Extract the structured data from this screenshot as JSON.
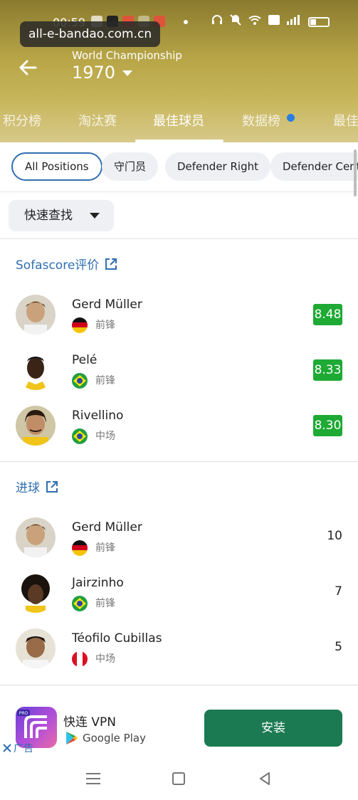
{
  "status_bar": {
    "time": "00:59"
  },
  "url_badge": "all-e-bandao.com.cn",
  "header": {
    "subtitle": "World Championship",
    "season": "1970"
  },
  "tabs": [
    {
      "label": "积分榜"
    },
    {
      "label": "淘汰赛"
    },
    {
      "label": "最佳球员"
    },
    {
      "label": "数据榜"
    },
    {
      "label": "最佳"
    }
  ],
  "chips": [
    "All Positions",
    "守门员",
    "Defender Right",
    "Defender Center"
  ],
  "quick_find": "快速查找",
  "sections": [
    {
      "title": "Sofascore评价",
      "players": [
        {
          "name": "Gerd Müller",
          "position": "前锋",
          "country": "germany",
          "value": "8.48"
        },
        {
          "name": "Pelé",
          "position": "前锋",
          "country": "brazil",
          "value": "8.33"
        },
        {
          "name": "Rivellino",
          "position": "中场",
          "country": "brazil",
          "value": "8.30"
        }
      ]
    },
    {
      "title": "进球",
      "players": [
        {
          "name": "Gerd Müller",
          "position": "前锋",
          "country": "germany",
          "value": "10"
        },
        {
          "name": "Jairzinho",
          "position": "前锋",
          "country": "brazil",
          "value": "7"
        },
        {
          "name": "Téofilo Cubillas",
          "position": "中场",
          "country": "peru",
          "value": "5"
        }
      ]
    }
  ],
  "ad": {
    "app_name": "快连 VPN",
    "store": "Google Play",
    "install_label": "安装",
    "ad_label": "广告",
    "icon_badge": "PRO"
  },
  "colors": {
    "accent": "#2f6fb0",
    "rating_green": "#1eaa34",
    "install_green": "#1b7a52",
    "notification_dot": "#2a7de1"
  }
}
